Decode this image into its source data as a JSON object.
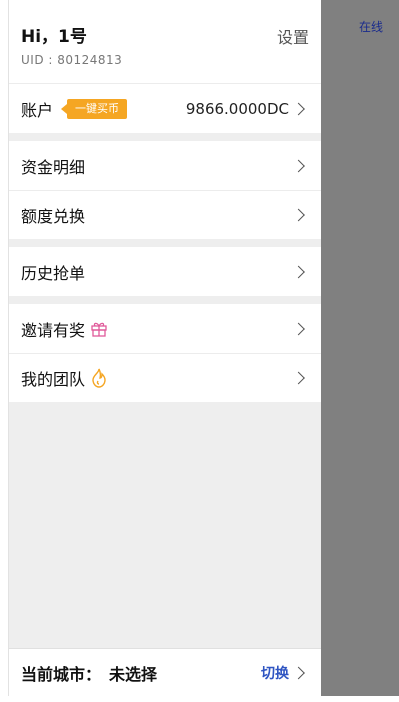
{
  "overlay": {
    "status": "在线"
  },
  "header": {
    "greeting": "Hi，1号",
    "uid": "UID : 80124813",
    "settings": "设置"
  },
  "account": {
    "label": "账户",
    "badge": "一键买币",
    "balance": "9866.0000DC"
  },
  "menu": {
    "fund_details": "资金明细",
    "quota_exchange": "额度兑换",
    "history_orders": "历史抢单",
    "invite_reward": "邀请有奖",
    "my_team": "我的团队"
  },
  "footer": {
    "city_label": "当前城市：",
    "city_value": "未选择",
    "switch": "切换"
  },
  "colors": {
    "badge": "#f5a623",
    "gift_icon": "#e05a9a",
    "flame_icon": "#f5a623",
    "switch": "#2f55c2"
  },
  "icons": [
    "gift-icon",
    "flame-icon",
    "chevron-right-icon"
  ]
}
